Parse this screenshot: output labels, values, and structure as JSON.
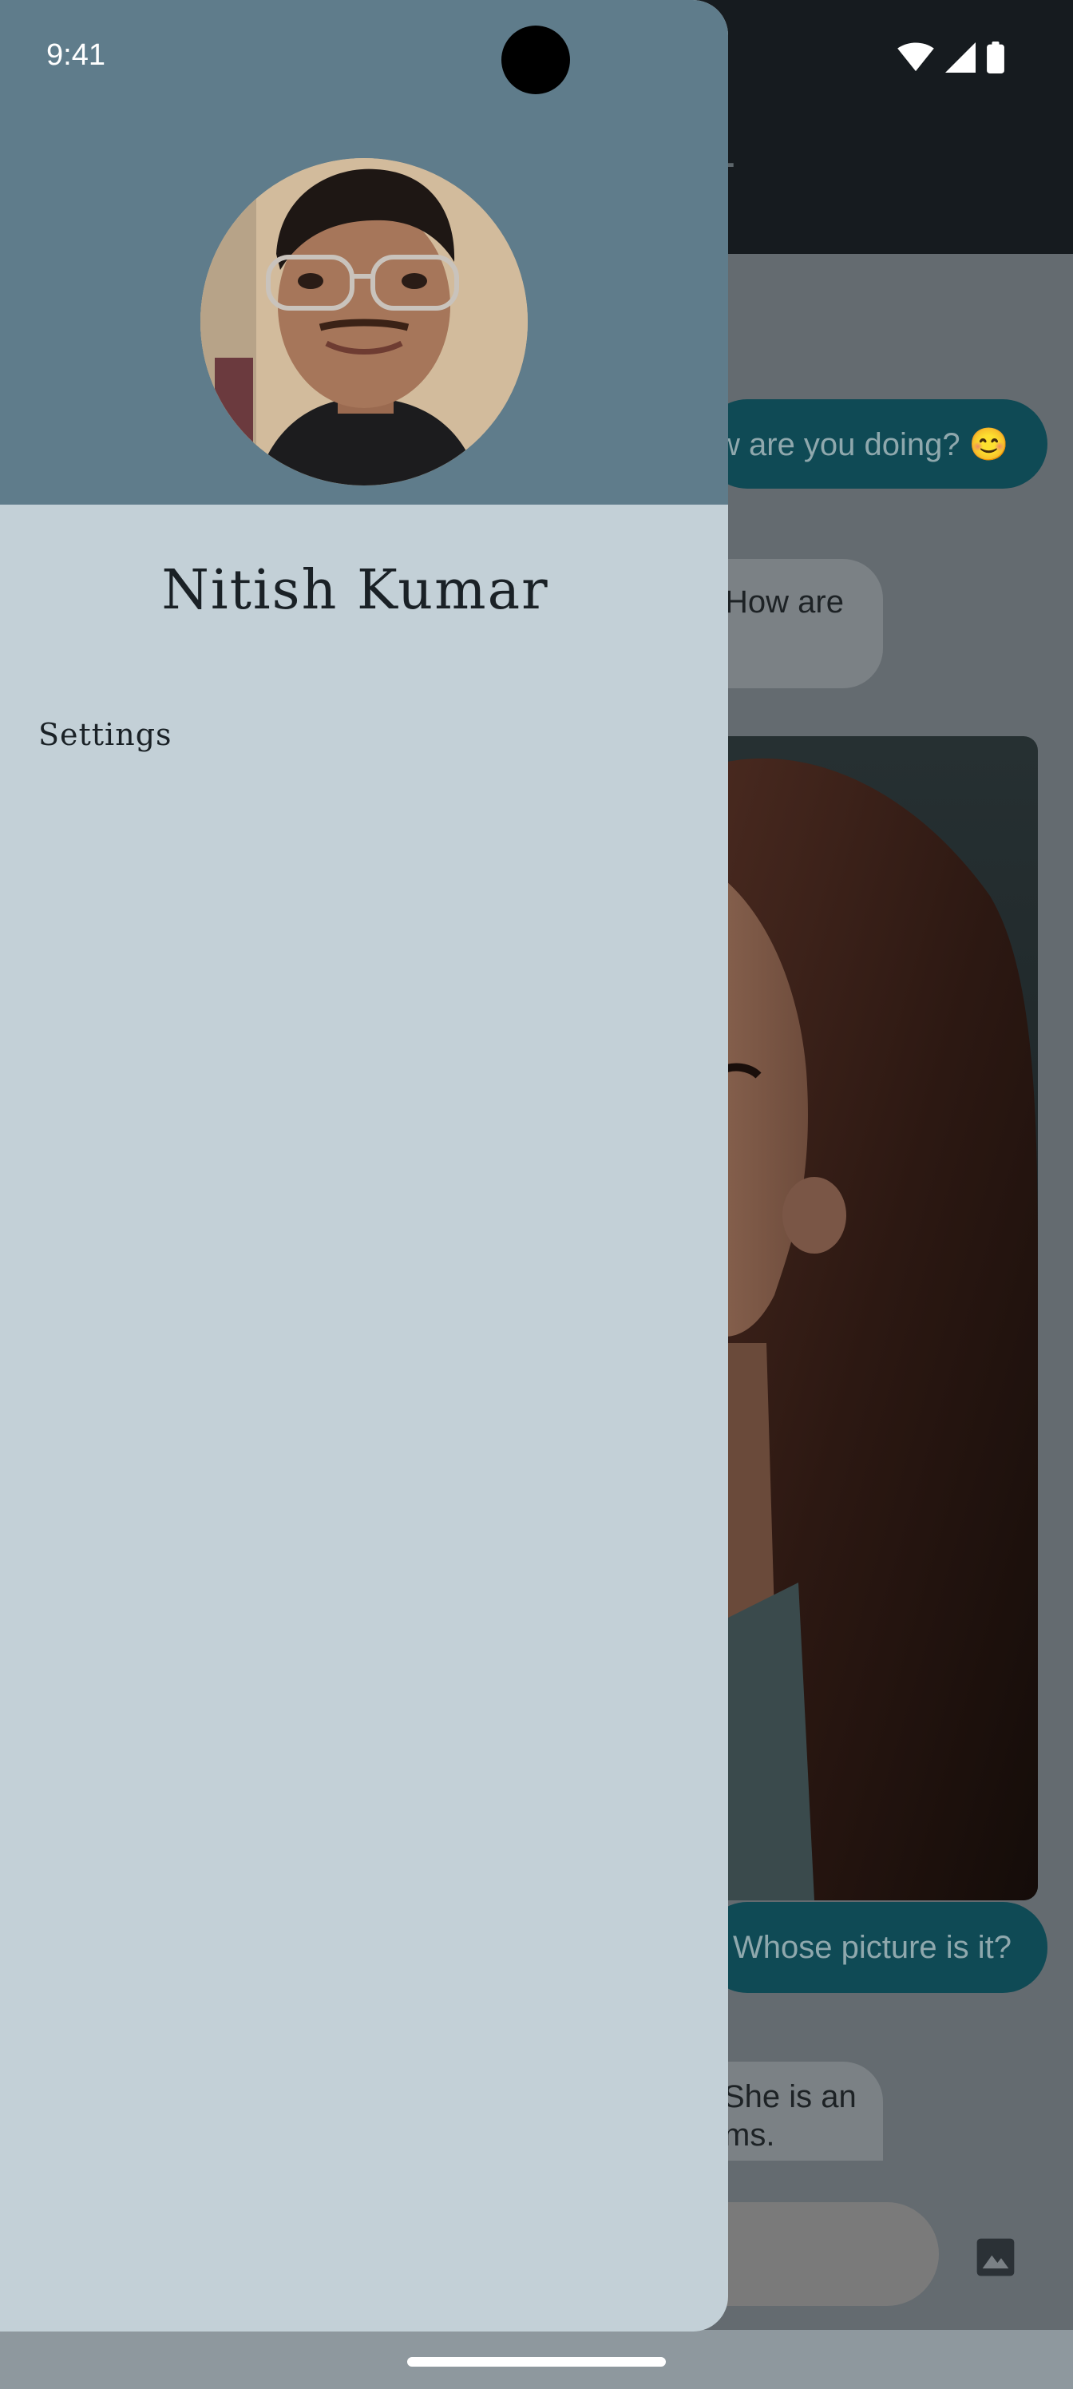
{
  "status_bar": {
    "time": "9:41"
  },
  "chat": {
    "messages": [
      {
        "type": "outgoing",
        "text": "w are you doing? 😊"
      },
      {
        "type": "incoming",
        "text": "How are"
      },
      {
        "type": "image"
      },
      {
        "type": "outgoing",
        "text": "Whose picture is it?"
      },
      {
        "type": "incoming",
        "line1": "She is an",
        "line2": "ms."
      }
    ]
  },
  "drawer": {
    "user_name": "Nitish Kumar",
    "menu": [
      {
        "label": "Settings"
      }
    ]
  },
  "icons": {
    "wifi": "wifi-icon",
    "signal": "cellular-signal-icon",
    "battery": "battery-icon",
    "image": "image-icon"
  },
  "colors": {
    "drawer_header": "#5f7c8b",
    "drawer_body": "#c3d0d7",
    "outgoing_bubble": "#0f4a55",
    "app_bar": "#161b1f"
  }
}
